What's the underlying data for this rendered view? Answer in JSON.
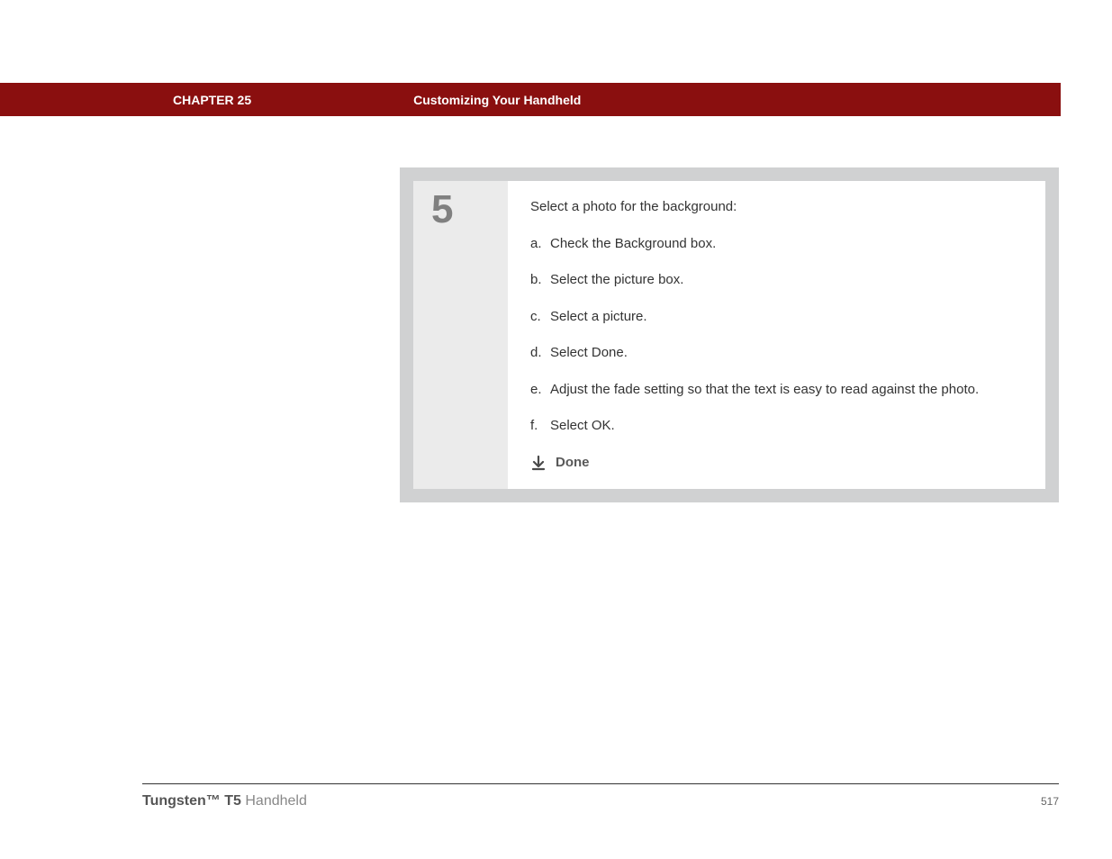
{
  "header": {
    "chapter": "CHAPTER 25",
    "title": "Customizing Your Handheld"
  },
  "step": {
    "number": "5",
    "intro": "Select a photo for the background:",
    "substeps": [
      {
        "marker": "a.",
        "text": "Check the Background box."
      },
      {
        "marker": "b.",
        "text": "Select the picture box."
      },
      {
        "marker": "c.",
        "text": "Select a picture."
      },
      {
        "marker": "d.",
        "text": "Select Done."
      },
      {
        "marker": "e.",
        "text": "Adjust the fade setting so that the text is easy to read against the photo."
      },
      {
        "marker": "f.",
        "text": "Select OK."
      }
    ],
    "done_label": "Done"
  },
  "footer": {
    "product_bold": "Tungsten™ T5",
    "product_rest": " Handheld",
    "page": "517"
  }
}
